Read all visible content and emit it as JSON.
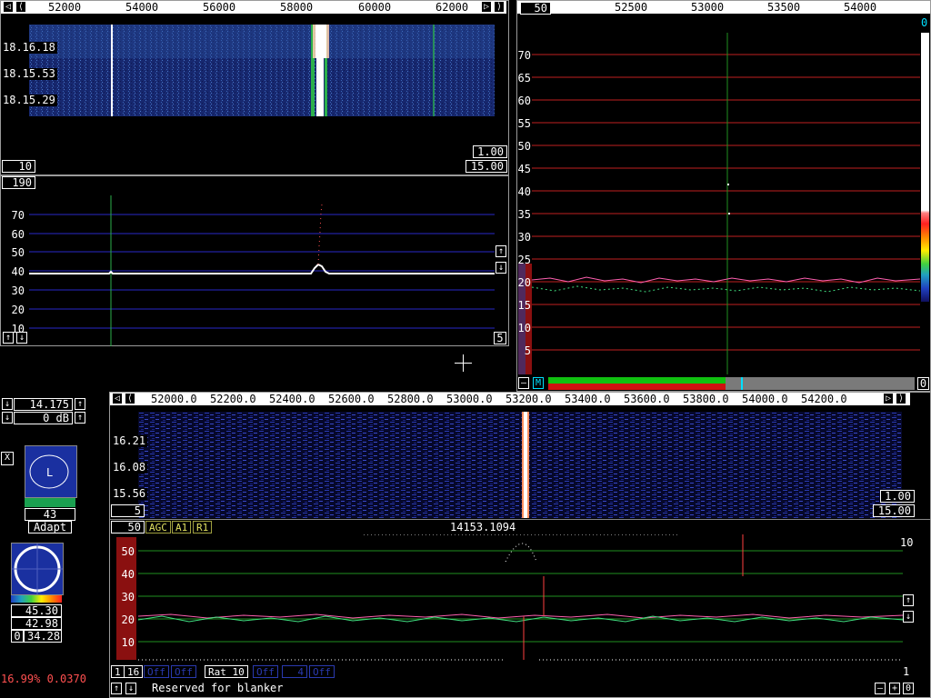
{
  "top_left": {
    "freq_scale": [
      "52000",
      "54000",
      "56000",
      "58000",
      "60000",
      "62000"
    ],
    "timestamps": [
      "18.16.18",
      "18.15.53",
      "18.15.29"
    ],
    "wf_box_a": "1.00",
    "wf_box_b": "15.00",
    "wf_avg": "10",
    "spec_box": "190",
    "spec_y": [
      "70",
      "60",
      "50",
      "40",
      "30",
      "20",
      "10"
    ],
    "spec_right": "5"
  },
  "top_right": {
    "freq_scale": [
      "52500",
      "53000",
      "53500",
      "54000"
    ],
    "box_left": "50",
    "box_right": "0",
    "y_ticks": [
      "70",
      "65",
      "60",
      "55",
      "50",
      "45",
      "40",
      "35",
      "30",
      "25",
      "20",
      "15",
      "10",
      "5"
    ],
    "minus_label": "–",
    "m_label": "M",
    "right_box": "0"
  },
  "controls": {
    "freq_value": "14.175",
    "gain_value": "0 dB",
    "x_label": "X",
    "l_label": "L",
    "level_value": "43",
    "adapt_label": "Adapt",
    "readout_a": "45.30",
    "readout_b": "42.98",
    "readout_c_prefix": "0",
    "readout_c": "34.28",
    "cpu_text": "16.99% 0.0370"
  },
  "bottom": {
    "freq_scale": [
      "52000.0",
      "52200.0",
      "52400.0",
      "52600.0",
      "52800.0",
      "53000.0",
      "53200.0",
      "53400.0",
      "53600.0",
      "53800.0",
      "54000.0",
      "54200.0"
    ],
    "timestamps": [
      "16.21",
      "16.08",
      "15.56"
    ],
    "wf_avg": "5",
    "wf_box_a": "1.00",
    "wf_box_b": "15.00",
    "spec_box": "50",
    "agc_label": "AGC",
    "a1_label": "A1",
    "r1_label": "R1",
    "center_freq": "14153.1094",
    "spec_y": [
      "50",
      "40",
      "30",
      "20",
      "10"
    ],
    "right_val": "10",
    "tags": [
      "1",
      "16",
      "Off",
      "Off",
      "Rat 10",
      "Off",
      "4",
      "Off"
    ],
    "status": "Reserved for blanker",
    "right_one": "1",
    "minus": "–",
    "plus": "+",
    "zero": "0"
  },
  "colors": {
    "grid_red": "#c02020",
    "grid_blue": "#2828c8",
    "grid_green": "#1f8f1f",
    "wf_blue": "#1a2a8a",
    "accent_cyan": "#00e0ff"
  },
  "icons": {
    "scroll_left": "left-arrow-icon",
    "scroll_right": "right-arrow-icon",
    "up": "up-arrow-icon",
    "down": "down-arrow-icon"
  }
}
